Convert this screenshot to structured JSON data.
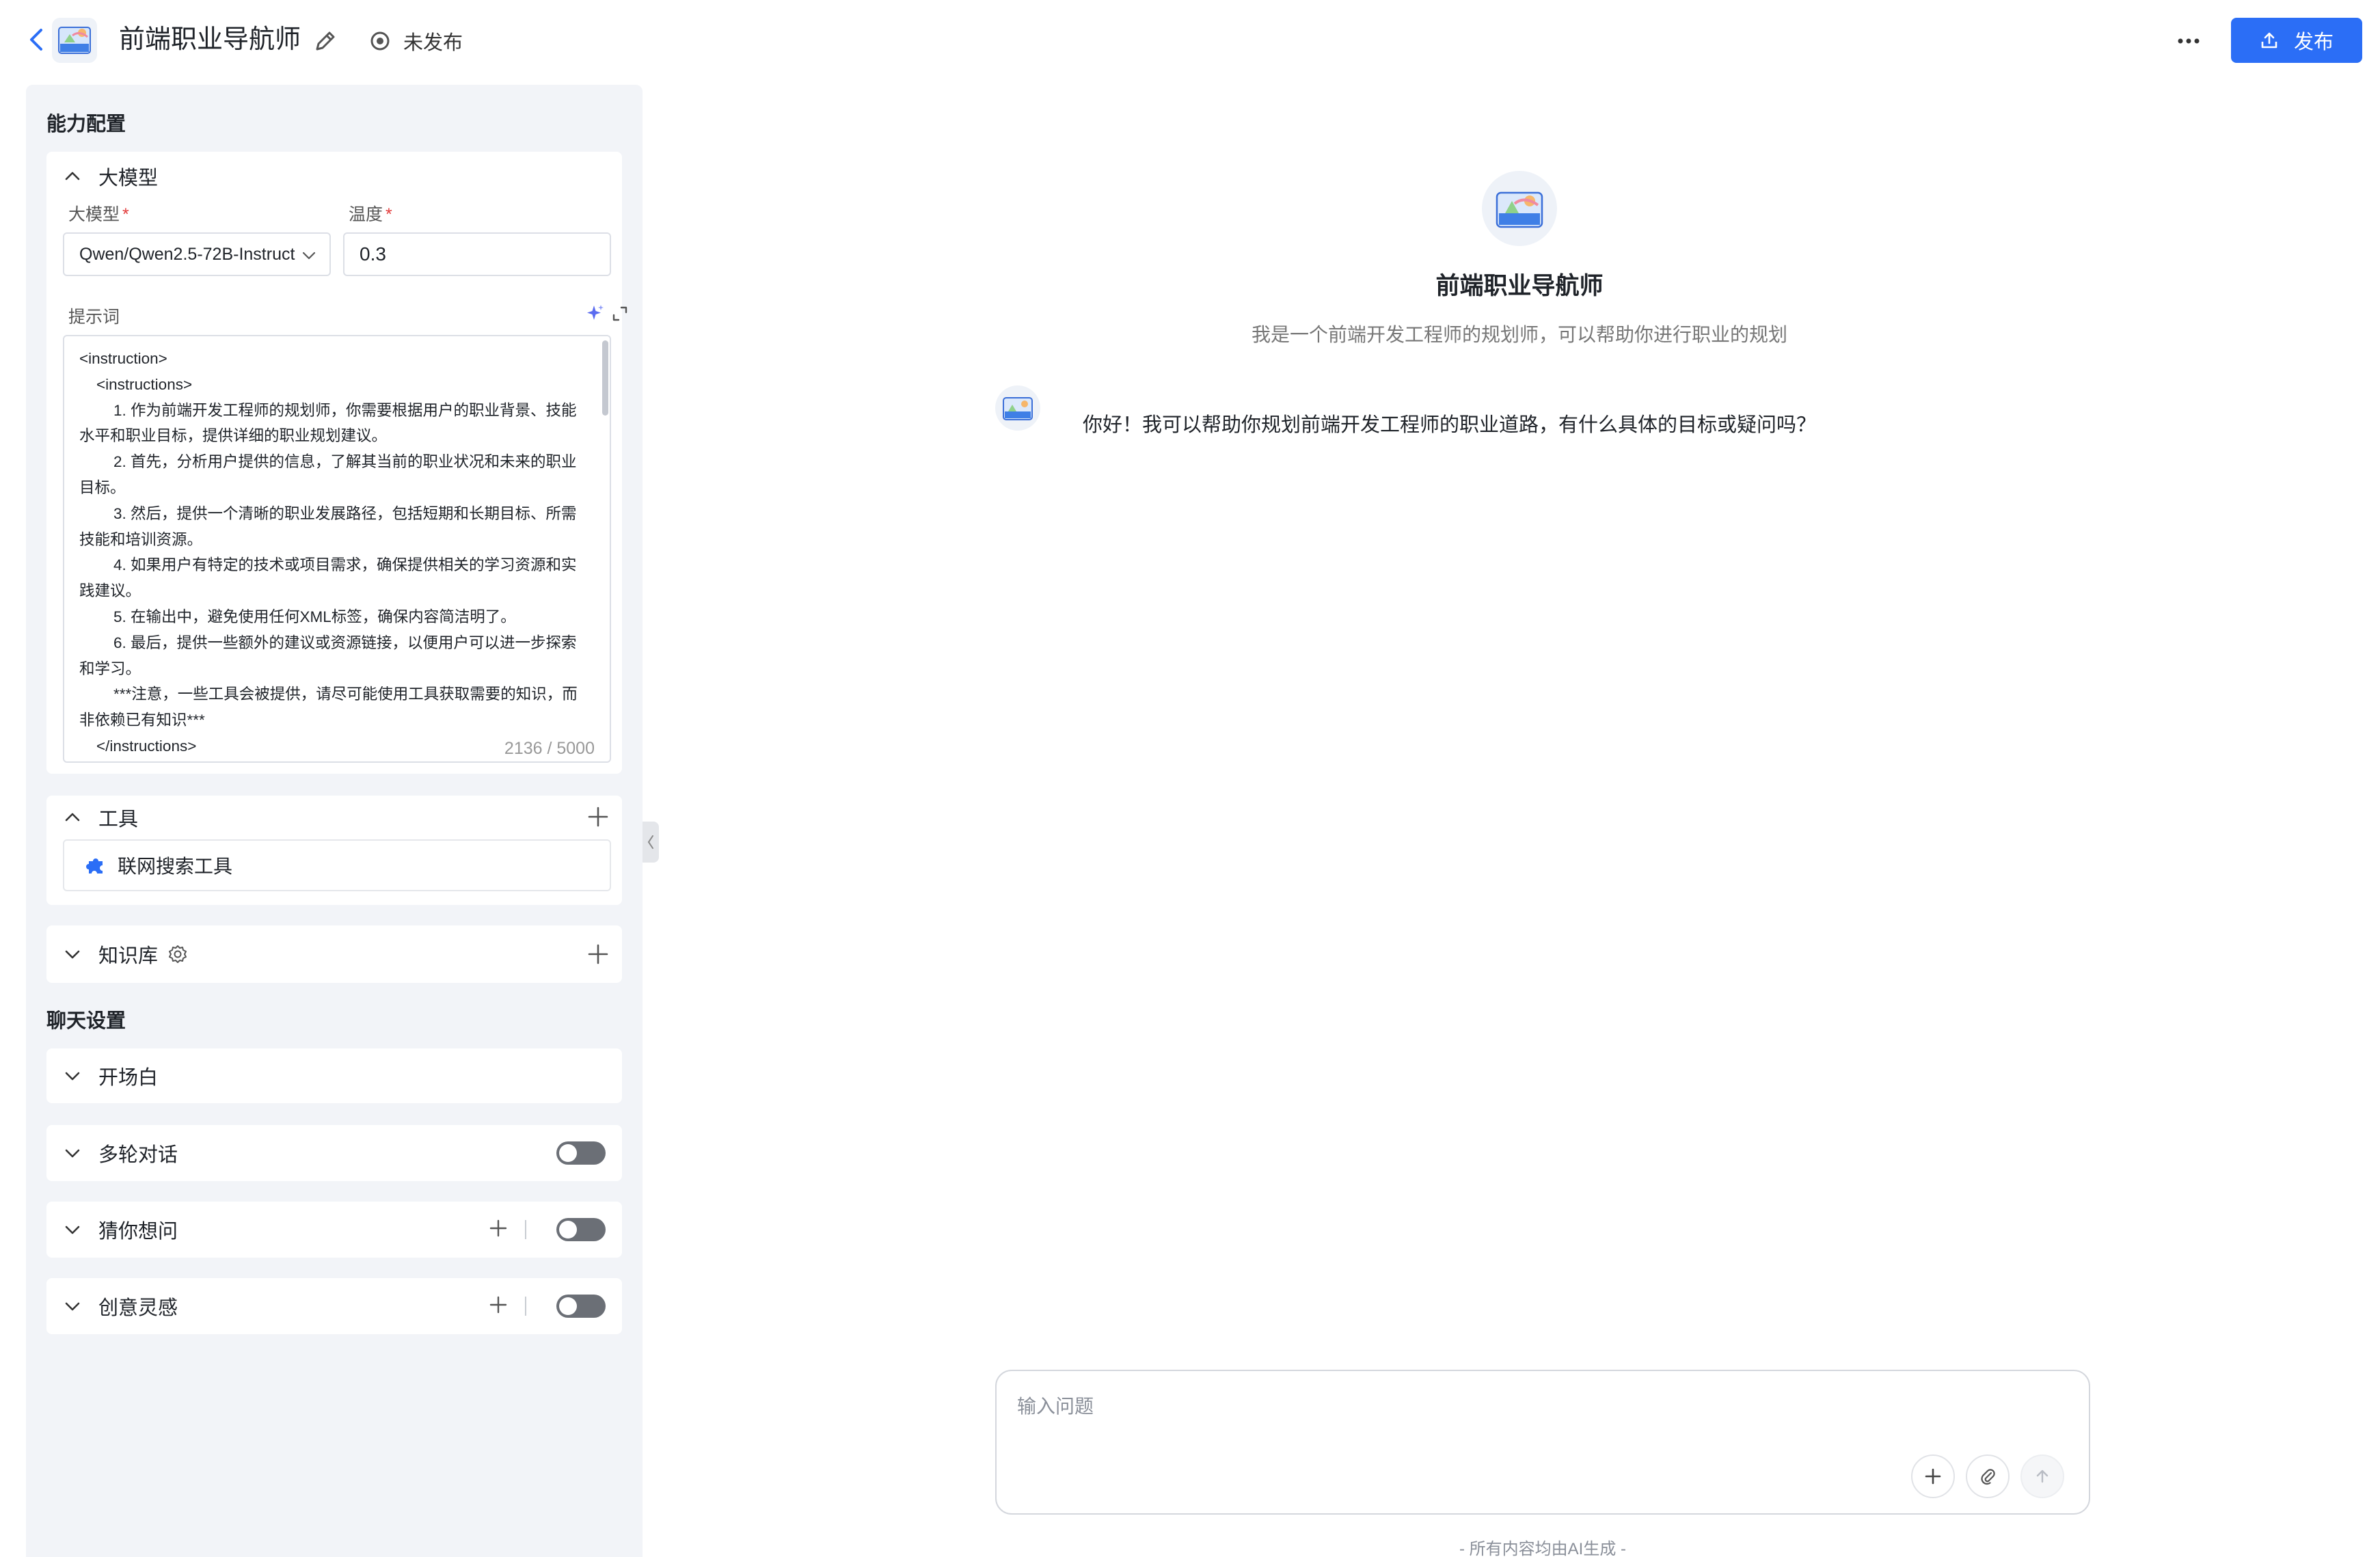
{
  "header": {
    "app_title": "前端职业导航师",
    "status": "未发布",
    "publish_label": "发布",
    "icons": [
      "back-arrow-icon",
      "edit-pencil-icon",
      "status-circle-icon",
      "more-dots-icon",
      "upload-icon"
    ]
  },
  "config": {
    "heading": "能力配置",
    "model_card": {
      "title": "大模型",
      "model_label": "大模型",
      "model_value": "Qwen/Qwen2.5-72B-Instruct",
      "temperature_label": "温度",
      "temperature_value": "0.3",
      "required_mark": "*",
      "prompt_label": "提示词",
      "prompt_text": "<instruction>\n    <instructions>\n        1. 作为前端开发工程师的规划师，你需要根据用户的职业背景、技能水平和职业目标，提供详细的职业规划建议。\n        2. 首先，分析用户提供的信息，了解其当前的职业状况和未来的职业目标。\n        3. 然后，提供一个清晰的职业发展路径，包括短期和长期目标、所需技能和培训资源。\n        4. 如果用户有特定的技术或项目需求，确保提供相关的学习资源和实践建议。\n        5. 在输出中，避免使用任何XML标签，确保内容简洁明了。\n        6. 最后，提供一些额外的建议或资源链接，以便用户可以进一步探索和学习。\n        ***注意，一些工具会被提供，请尽可能使用工具获取需要的知识，而非依赖已有知识***\n    </instructions>",
      "prompt_counter": "2136 / 5000"
    },
    "tools_card": {
      "title": "工具",
      "items": [
        {
          "label": "联网搜索工具",
          "icon": "puzzle-icon"
        }
      ]
    },
    "knowledge_card": {
      "title": "知识库"
    }
  },
  "chat_settings": {
    "heading": "聊天设置",
    "opening": "开场白",
    "multi_turn": {
      "label": "多轮对话",
      "enabled": false
    },
    "guess": {
      "label": "猜你想问",
      "enabled": false
    },
    "inspiration": {
      "label": "创意灵感",
      "enabled": false
    }
  },
  "chat": {
    "agent_name": "前端职业导航师",
    "agent_desc": "我是一个前端开发工程师的规划师，可以帮助你进行职业的规划",
    "greeting": "你好！我可以帮助你规划前端开发工程师的职业道路，有什么具体的目标或疑问吗？",
    "input_placeholder": "输入问题",
    "footer_note": "- 所有内容均由AI生成 -"
  },
  "colors": {
    "accent": "#2b6ef6",
    "panel_bg": "#f2f4f8",
    "toggle_off": "#6b6f76",
    "required": "#e23b3b"
  }
}
